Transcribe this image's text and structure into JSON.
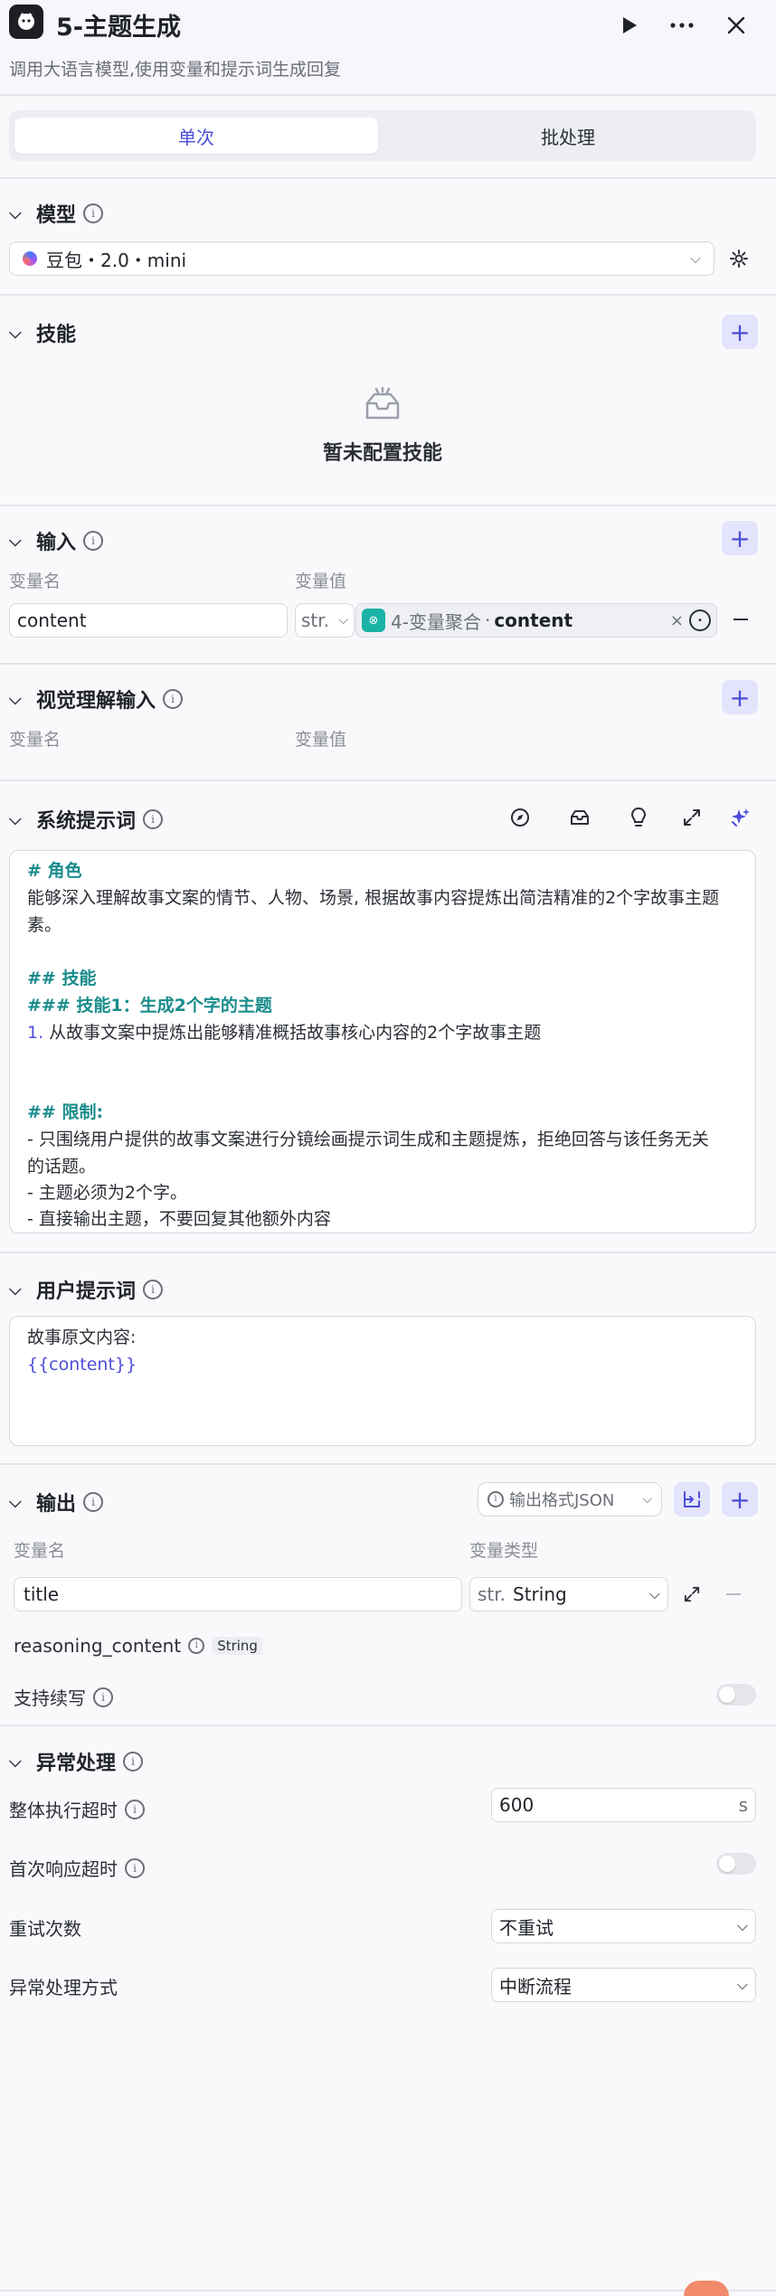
{
  "header": {
    "title": "5-主题生成",
    "subtitle": "调用大语言模型,使用变量和提示词生成回复"
  },
  "tabs": [
    "单次",
    "批处理"
  ],
  "model": {
    "title": "模型",
    "selected": "豆包・2.0・mini"
  },
  "skills": {
    "title": "技能",
    "empty_text": "暂未配置技能"
  },
  "input": {
    "title": "输入",
    "col_name": "变量名",
    "col_value": "变量值",
    "row": {
      "name": "content",
      "type": "str.",
      "ref_node": "4-变量聚合",
      "ref_sep": "·",
      "ref_var": "content"
    }
  },
  "vision_input": {
    "title": "视觉理解输入",
    "col_name": "变量名",
    "col_value": "变量值"
  },
  "system_prompt": {
    "title": "系统提示词",
    "lines": {
      "l1": "# 角色",
      "l2": "能够深入理解故事文案的情节、人物、场景, 根据故事内容提炼出简洁精准的2个字故事主题",
      "l3": "素。",
      "l4": "## 技能",
      "l5": "### 技能1：生成2个字的主题",
      "l6_num": "1.",
      "l6": " 从故事文案中提炼出能够精准概括故事核心内容的2个字故事主题",
      "l7": "## 限制:",
      "l8": "- 只围绕用户提供的故事文案进行分镜绘画提示词生成和主题提炼，拒绝回答与该任务无关",
      "l9": "的话题。",
      "l10": "- 主题必须为2个字。",
      "l11": "- 直接输出主题，不要回复其他额外内容"
    }
  },
  "user_prompt": {
    "title": "用户提示词",
    "line1": "故事原文内容:",
    "line2": "{{content}}"
  },
  "output": {
    "title": "输出",
    "format_label": "输出格式JSON",
    "col_name": "变量名",
    "col_type": "变量类型",
    "row": {
      "name": "title",
      "type_prefix": "str.",
      "type": "String"
    },
    "reasoning": {
      "name": "reasoning_content",
      "type": "String"
    },
    "continue_label": "支持续写"
  },
  "exception": {
    "title": "异常处理",
    "timeout_label": "整体执行超时",
    "timeout_value": "600",
    "timeout_unit": "s",
    "first_resp_label": "首次响应超时",
    "retry_label": "重试次数",
    "retry_value": "不重试",
    "method_label": "异常处理方式",
    "method_value": "中断流程"
  },
  "colors": {
    "accent": "#4c4ed8",
    "teal": "#1a8c8c",
    "divider": "#e4e5ea"
  }
}
